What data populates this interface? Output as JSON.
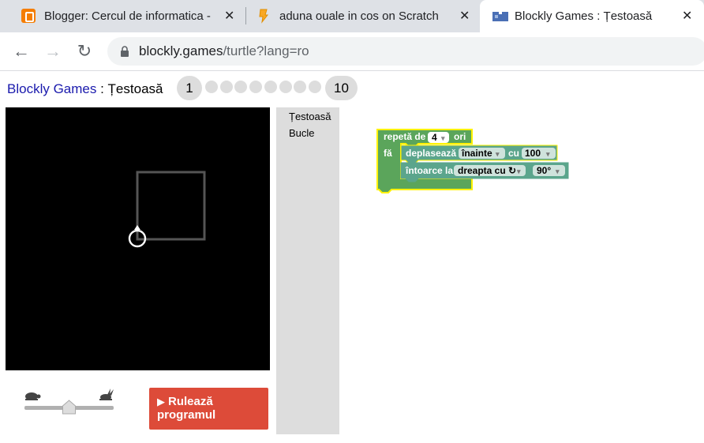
{
  "browser": {
    "tabs": [
      {
        "title": "Blogger: Cercul de informatica - E",
        "icon": "blogger-icon",
        "close": "✕"
      },
      {
        "title": "aduna ouale in cos on Scratch",
        "icon": "scratch-icon",
        "close": "✕"
      },
      {
        "title": "Blockly Games : Țestoasă",
        "icon": "blockly-icon",
        "close": "✕",
        "active": true
      }
    ],
    "address": {
      "host": "blockly.games",
      "path": "/turtle?lang=ro"
    },
    "nav": {
      "back": "←",
      "forward": "→",
      "reload": "↻"
    }
  },
  "header": {
    "brand": "Blockly Games",
    "separator": " : ",
    "game": "Țestoasă",
    "level_first": "1",
    "level_last": "10",
    "intermediate_levels": 8
  },
  "toolbox": {
    "categories": [
      "Țestoasă",
      "Bucle"
    ]
  },
  "workspace": {
    "repeat_block": {
      "label": "repetă de",
      "count": "4",
      "suffix": "ori",
      "do_label": "fă"
    },
    "move_block": {
      "label": "deplasează",
      "direction": "înainte",
      "by_label": "cu",
      "amount": "100"
    },
    "turn_block": {
      "label": "întoarce la",
      "direction": "dreapta cu ↻",
      "angle": "90°"
    }
  },
  "controls": {
    "run_button": {
      "play_glyph": "▶",
      "line1": "Rulează",
      "line2": "programul"
    },
    "speed_slider": {
      "value": 0.5
    }
  },
  "colors": {
    "accent_run": "#dd4b39",
    "loop_block": "#5ba55b",
    "turtle_block": "#5ba58c",
    "highlight": "#fff200",
    "canvas": "#000000",
    "link": "#1a1aad"
  }
}
